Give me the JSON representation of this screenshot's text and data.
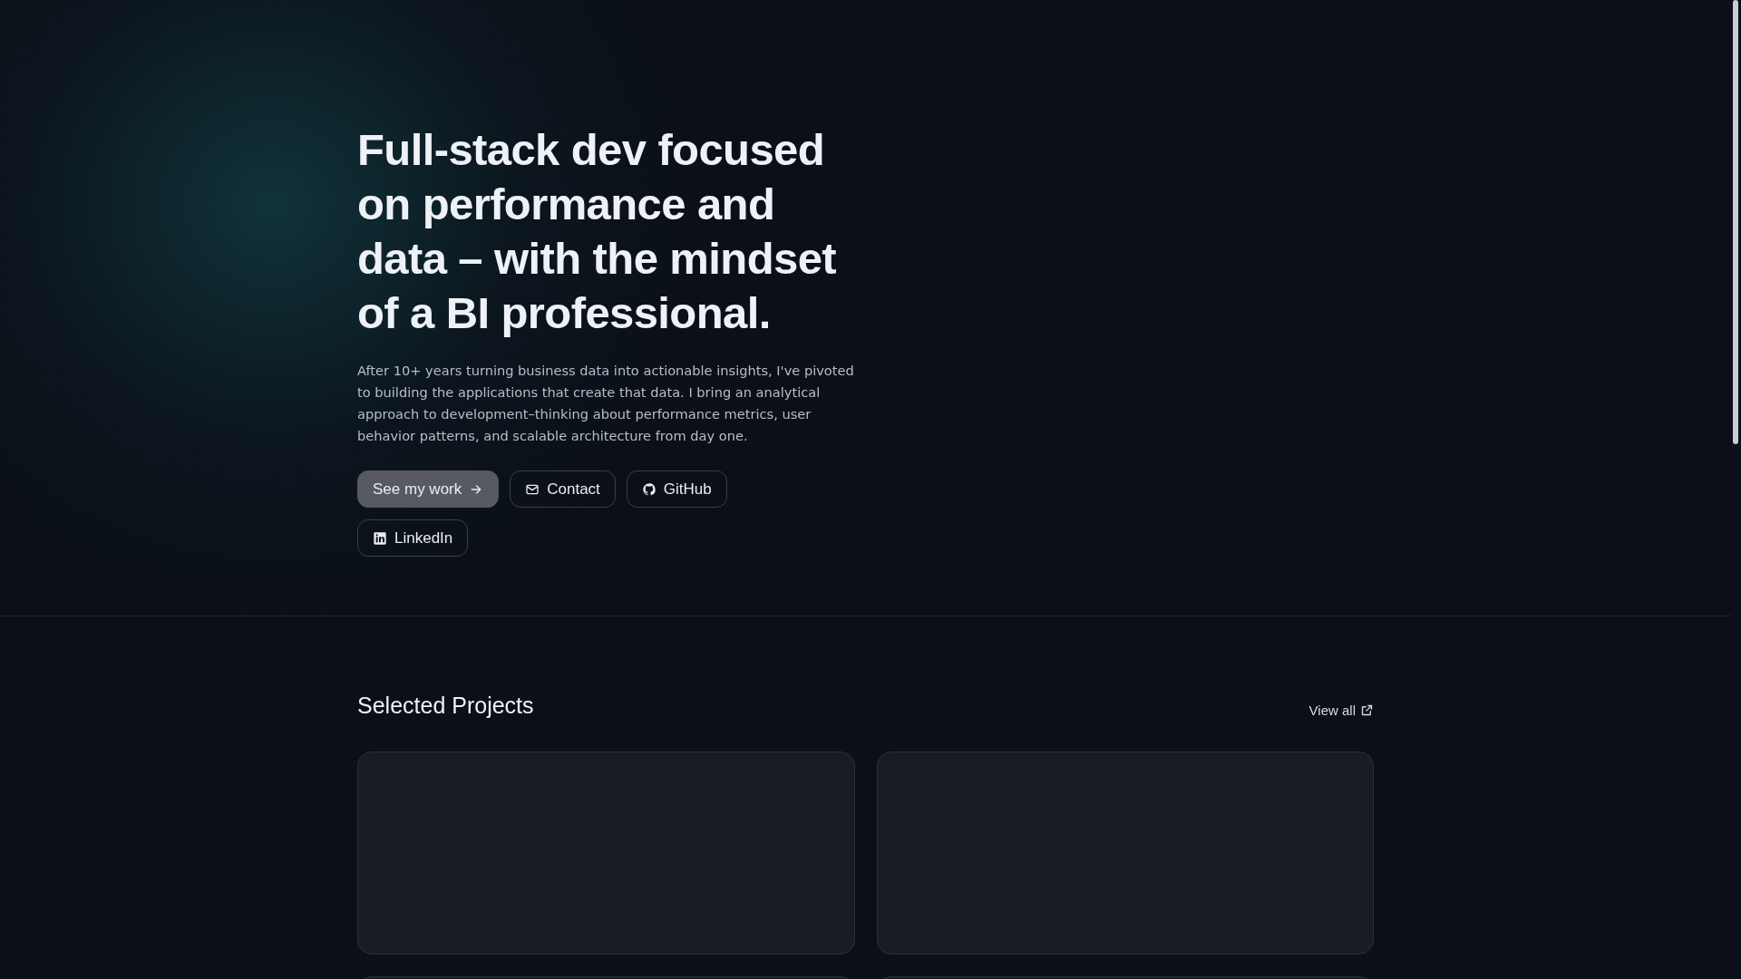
{
  "hero": {
    "headline": "Full-stack dev focused on performance and data – with the mindset of a BI professional.",
    "intro": "After 10+ years turning business data into actionable insights, I've pivoted to building the applications that create that data. I bring an analytical approach to development–thinking about performance metrics, user behavior patterns, and scalable architecture from day one.",
    "buttons": [
      {
        "label": "See my work",
        "kind": "primary"
      },
      {
        "label": "Contact",
        "kind": "mail"
      },
      {
        "label": "GitHub",
        "kind": "github"
      },
      {
        "label": "LinkedIn",
        "kind": "linkedin"
      }
    ]
  },
  "projects": {
    "title": "Selected Projects",
    "view_all": "View all"
  }
}
